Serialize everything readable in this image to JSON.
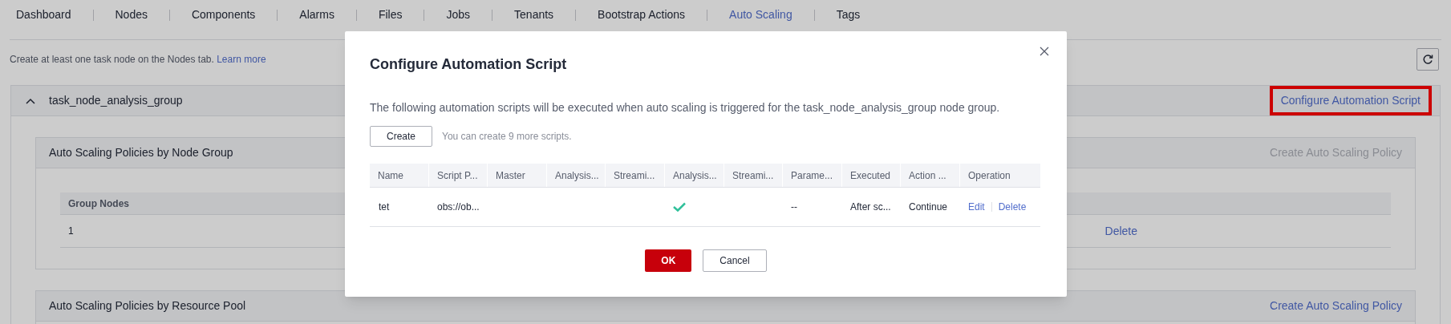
{
  "tabs": [
    {
      "label": "Dashboard",
      "selected": false
    },
    {
      "label": "Nodes",
      "selected": false
    },
    {
      "label": "Components",
      "selected": false
    },
    {
      "label": "Alarms",
      "selected": false
    },
    {
      "label": "Files",
      "selected": false
    },
    {
      "label": "Jobs",
      "selected": false
    },
    {
      "label": "Tenants",
      "selected": false
    },
    {
      "label": "Bootstrap Actions",
      "selected": false
    },
    {
      "label": "Auto Scaling",
      "selected": true
    },
    {
      "label": "Tags",
      "selected": false
    }
  ],
  "info": {
    "text": "Create at least one task node on the Nodes tab.",
    "link": "Learn more"
  },
  "group": {
    "name": "task_node_analysis_group",
    "expanded": true,
    "action": "Configure Automation Script",
    "action_highlighted": true,
    "node_group_policies": {
      "title": "Auto Scaling Policies by Node Group",
      "action": "Create Auto Scaling Policy",
      "action_disabled": true,
      "columns": [
        "Group Nodes"
      ],
      "rows": [
        {
          "cells": [
            "1"
          ],
          "operation": "Delete"
        }
      ]
    },
    "resource_pool_policies": {
      "title": "Auto Scaling Policies by Resource Pool",
      "action": "Create Auto Scaling Policy",
      "action_disabled": false
    }
  },
  "dialog": {
    "title": "Configure Automation Script",
    "description": "The following automation scripts will be executed when auto scaling is triggered for the task_node_analysis_group node group.",
    "create_button": "Create",
    "hint": "You can create 9 more scripts.",
    "columns": [
      "Name",
      "Script P...",
      "Master",
      "Analysis...",
      "Streami...",
      "Analysis...",
      "Streami...",
      "Parame...",
      "Executed",
      "Action ...",
      "Operation"
    ],
    "rows": [
      {
        "cells": [
          {
            "kind": "text",
            "text": "tet"
          },
          {
            "kind": "text",
            "text": "obs://ob..."
          },
          {
            "kind": "blank"
          },
          {
            "kind": "blank"
          },
          {
            "kind": "blank"
          },
          {
            "kind": "check",
            "checked": true
          },
          {
            "kind": "blank"
          },
          {
            "kind": "text",
            "text": "--"
          },
          {
            "kind": "text",
            "text": "After sc..."
          },
          {
            "kind": "text",
            "text": "Continue"
          }
        ],
        "operations": [
          "Edit",
          "Delete"
        ]
      }
    ],
    "buttons": [
      {
        "label": "OK",
        "kind": "primary"
      },
      {
        "label": "Cancel",
        "kind": "secondary"
      }
    ]
  }
}
